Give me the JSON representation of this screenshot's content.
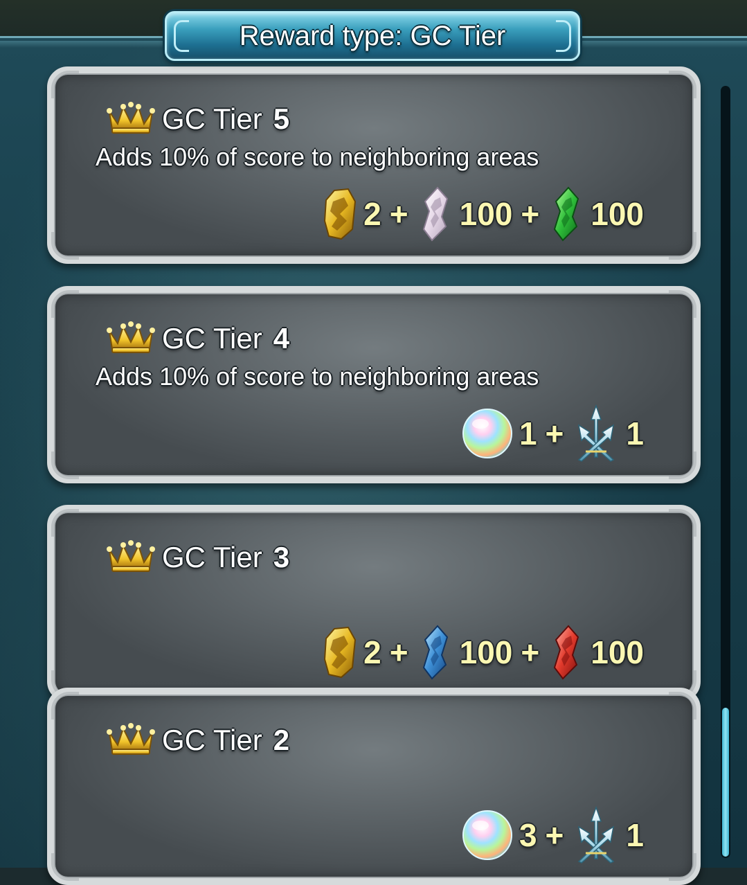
{
  "header": {
    "title": "Reward type: GC Tier"
  },
  "tiers": [
    {
      "label": "GC Tier",
      "number": "5",
      "description": "Adds 10% of score to neighboring areas",
      "rewards": [
        {
          "icon": "gold-badge-icon",
          "value": "2"
        },
        {
          "icon": "transparent-shard-icon",
          "value": "100"
        },
        {
          "icon": "green-shard-icon",
          "value": "100"
        }
      ]
    },
    {
      "label": "GC Tier",
      "number": "4",
      "description": "Adds 10% of score to neighboring areas",
      "rewards": [
        {
          "icon": "rainbow-orb-icon",
          "value": "1"
        },
        {
          "icon": "arrow-emblem-icon",
          "value": "1"
        }
      ]
    },
    {
      "label": "GC Tier",
      "number": "3",
      "description": "",
      "rewards": [
        {
          "icon": "gold-badge-icon",
          "value": "2"
        },
        {
          "icon": "blue-shard-icon",
          "value": "100"
        },
        {
          "icon": "red-shard-icon",
          "value": "100"
        }
      ]
    },
    {
      "label": "GC Tier",
      "number": "2",
      "description": "",
      "rewards": [
        {
          "icon": "rainbow-orb-icon",
          "value": "3"
        },
        {
          "icon": "arrow-emblem-icon",
          "value": "1"
        }
      ]
    }
  ],
  "plus_sign": "+",
  "colors": {
    "reward_value": "#fbf7b2",
    "card_border": "#d6dadb",
    "tab_accent": "#3a9fbd",
    "scroll_thumb": "#8fe4f4"
  }
}
